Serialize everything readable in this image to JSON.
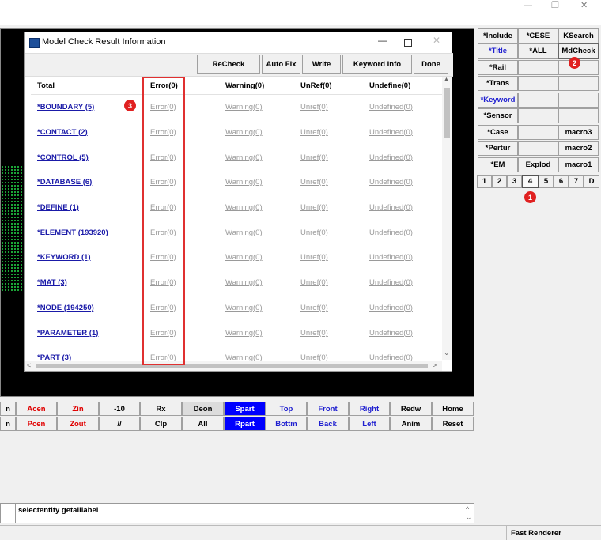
{
  "window_controls": {
    "minimize": "—",
    "restore": "❐",
    "close": "✕"
  },
  "dialog": {
    "title": "Model Check Result Information",
    "toolbar": [
      "ReCheck",
      "Auto Fix",
      "Write",
      "Keyword Info",
      "Done"
    ],
    "headers": {
      "total": "Total",
      "error": "Error(0)",
      "warning": "Warning(0)",
      "unref": "UnRef(0)",
      "undefine": "Undefine(0)"
    },
    "rows": [
      {
        "name": "*BOUNDARY (5)",
        "error": "Error(0)",
        "warning": "Warning(0)",
        "unref": "Unref(0)",
        "undefine": "Undefined(0)"
      },
      {
        "name": "*CONTACT (2)",
        "error": "Error(0)",
        "warning": "Warning(0)",
        "unref": "Unref(0)",
        "undefine": "Undefined(0)"
      },
      {
        "name": "*CONTROL (5)",
        "error": "Error(0)",
        "warning": "Warning(0)",
        "unref": "Unref(0)",
        "undefine": "Undefined(0)"
      },
      {
        "name": "*DATABASE (6)",
        "error": "Error(0)",
        "warning": "Warning(0)",
        "unref": "Unref(0)",
        "undefine": "Undefined(0)"
      },
      {
        "name": "*DEFINE (1)",
        "error": "Error(0)",
        "warning": "Warning(0)",
        "unref": "Unref(0)",
        "undefine": "Undefined(0)"
      },
      {
        "name": "*ELEMENT (193920)",
        "error": "Error(0)",
        "warning": "Warning(0)",
        "unref": "Unref(0)",
        "undefine": "Undefined(0)"
      },
      {
        "name": "*KEYWORD (1)",
        "error": "Error(0)",
        "warning": "Warning(0)",
        "unref": "Unref(0)",
        "undefine": "Undefined(0)"
      },
      {
        "name": "*MAT (3)",
        "error": "Error(0)",
        "warning": "Warning(0)",
        "unref": "Unref(0)",
        "undefine": "Undefined(0)"
      },
      {
        "name": "*NODE (194250)",
        "error": "Error(0)",
        "warning": "Warning(0)",
        "unref": "Unref(0)",
        "undefine": "Undefined(0)"
      },
      {
        "name": "*PARAMETER (1)",
        "error": "Error(0)",
        "warning": "Warning(0)",
        "unref": "Unref(0)",
        "undefine": "Undefined(0)"
      },
      {
        "name": "*PART (3)",
        "error": "Error(0)",
        "warning": "Warning(0)",
        "unref": "Unref(0)",
        "undefine": "Undefined(0)"
      }
    ],
    "scroll": {
      "up": "▲",
      "down": "⌄",
      "left": "<",
      "right": ">"
    }
  },
  "right_panel": {
    "grid": [
      [
        "*Include",
        "*CESE",
        "KSearch"
      ],
      [
        "*Title",
        "*ALL",
        "MdCheck"
      ],
      [
        "*Rail",
        "",
        ""
      ],
      [
        "*Trans",
        "",
        ""
      ],
      [
        "*Keyword",
        "",
        ""
      ],
      [
        "*Sensor",
        "",
        ""
      ],
      [
        "*Case",
        "",
        "macro3"
      ],
      [
        "*Pertur",
        "",
        "macro2"
      ],
      [
        "*EM",
        "Explod",
        "macro1"
      ]
    ],
    "pages": [
      "1",
      "2",
      "3",
      "4",
      "5",
      "6",
      "7",
      "D"
    ]
  },
  "bottom_toolbar": {
    "row1": [
      "n",
      "Acen",
      "Zin",
      "-10",
      "Rx",
      "Deon",
      "Spart",
      "Top",
      "Front",
      "Right",
      "Redw",
      "Home"
    ],
    "row2": [
      "n",
      "Pcen",
      "Zout",
      "//",
      "Clp",
      "All",
      "Rpart",
      "Bottm",
      "Back",
      "Left",
      "Anim",
      "Reset"
    ]
  },
  "command": {
    "text": "selectentity getalllabel"
  },
  "status": {
    "renderer": "Fast Renderer"
  },
  "annotations": [
    "1",
    "2",
    "3"
  ],
  "colors": {
    "highlight_box": "#e03030",
    "annotation": "#e02020",
    "link_blue": "#1a1aa8",
    "blue_button": "#0000ff"
  }
}
